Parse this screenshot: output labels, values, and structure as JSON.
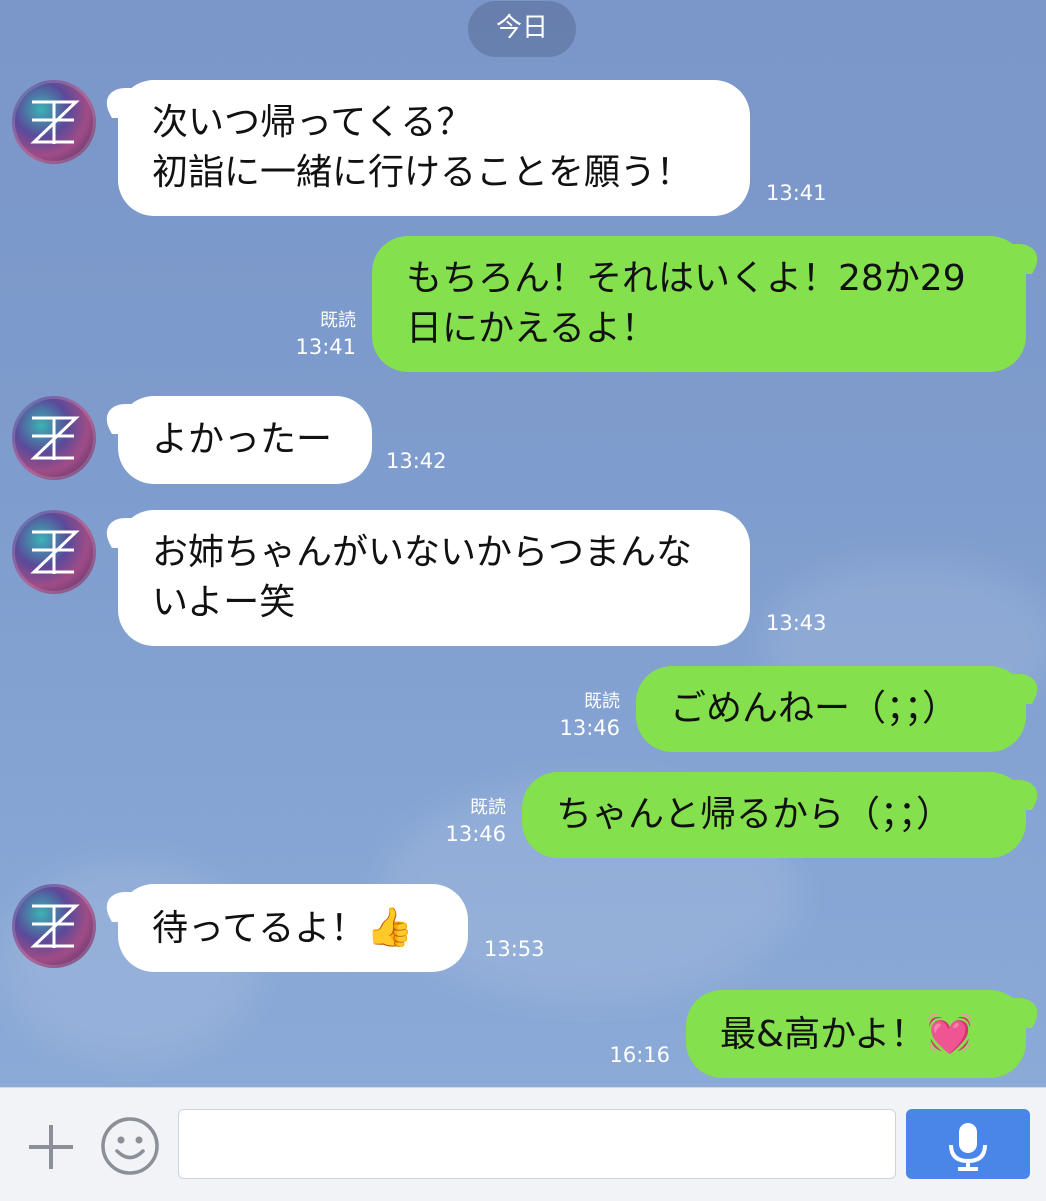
{
  "date_label": "今日",
  "messages": [
    {
      "side": "in",
      "lines": [
        "次いつ帰ってくる？",
        "初詣に一緒に行けることを願う！"
      ],
      "time": "13:41"
    },
    {
      "side": "out",
      "lines": [
        "もちろん！それはいくよ！28か29",
        "日にかえるよ！"
      ],
      "read": "既読",
      "time": "13:41"
    },
    {
      "side": "in",
      "lines": [
        "よかったー"
      ],
      "time": "13:42"
    },
    {
      "side": "in",
      "lines": [
        "お姉ちゃんがいないからつまんな",
        "いよー笑"
      ],
      "time": "13:43"
    },
    {
      "side": "out",
      "lines": [
        "ごめんねー（；；）"
      ],
      "read": "既読",
      "time": "13:46"
    },
    {
      "side": "out",
      "lines": [
        "ちゃんと帰るから（；；）"
      ],
      "read": "既読",
      "time": "13:46"
    },
    {
      "side": "in",
      "lines": [
        "待ってるよ！"
      ],
      "emoji": "👍",
      "time": "13:53"
    },
    {
      "side": "out",
      "lines": [
        "最&高かよ！"
      ],
      "emoji": "💓",
      "time": "16:16"
    }
  ],
  "composer": {
    "placeholder": "",
    "icons": {
      "add": "plus-icon",
      "sticker": "smiley-icon",
      "voice": "microphone-icon"
    }
  },
  "colors": {
    "background": "#7e9ccd",
    "incoming_bubble": "#ffffff",
    "outgoing_bubble": "#84e04c",
    "mic_button": "#4a86e8"
  }
}
